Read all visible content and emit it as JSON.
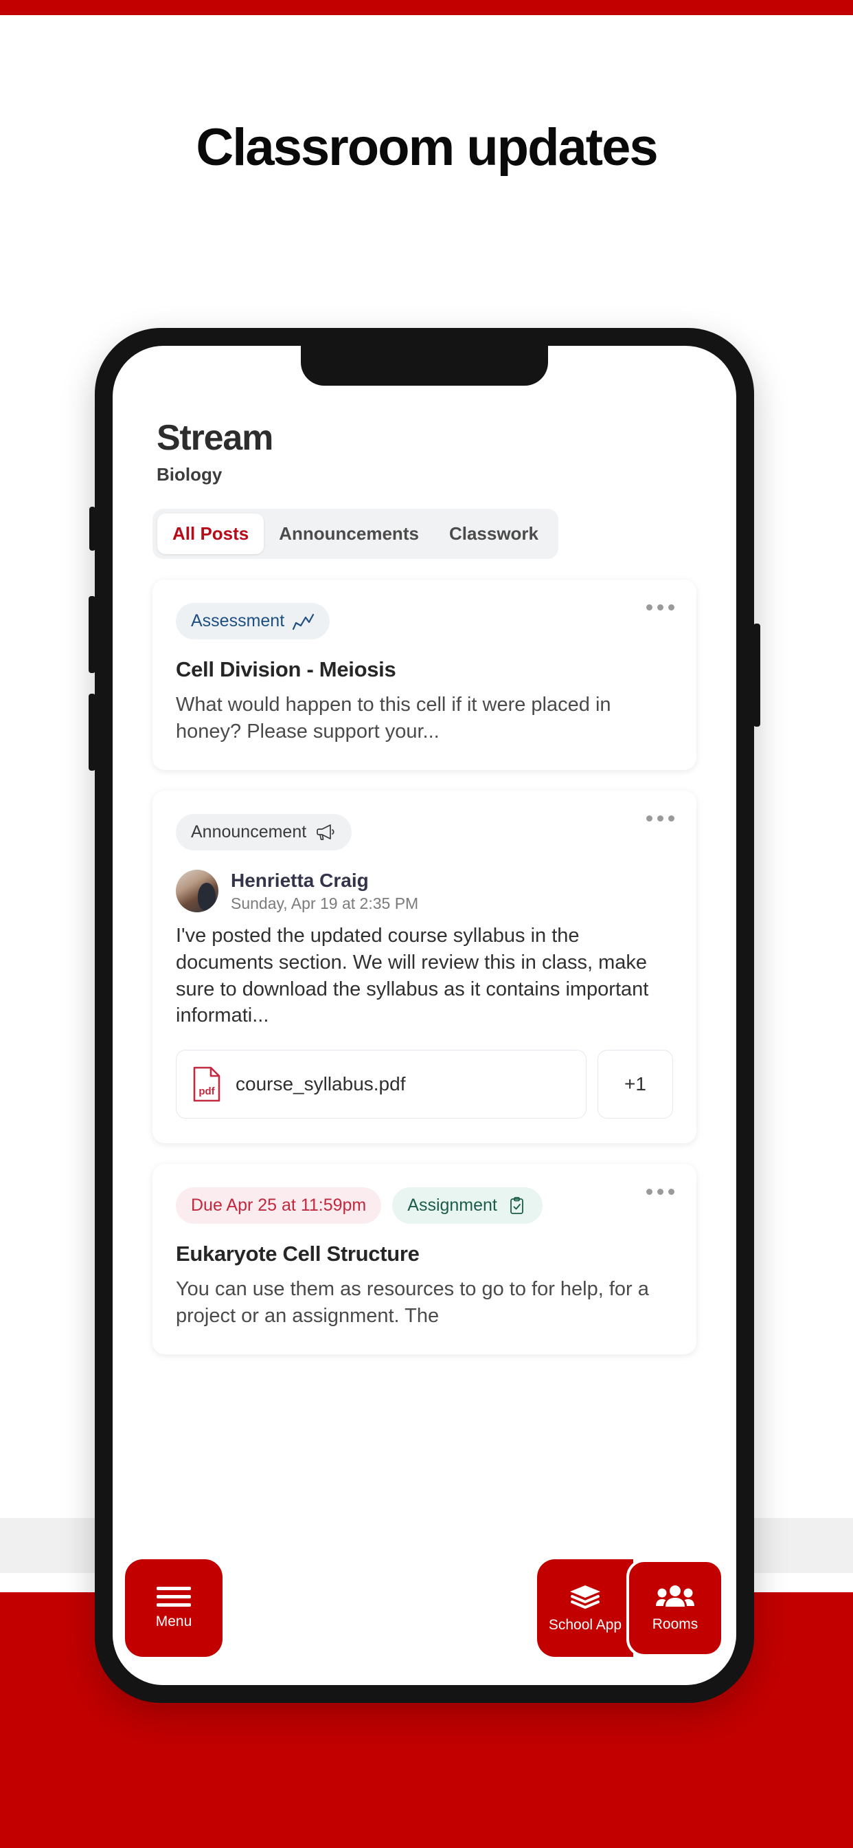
{
  "headline": "Classroom updates",
  "colors": {
    "brand_red": "#C20000",
    "accent_red": "#B80A18",
    "due_red": "#C2283E",
    "assessment_blue": "#1d4f82",
    "assignment_green": "#1c5c4a"
  },
  "app": {
    "title": "Stream",
    "subtitle": "Biology",
    "tabs": [
      {
        "label": "All Posts",
        "active": true
      },
      {
        "label": "Announcements",
        "active": false
      },
      {
        "label": "Classwork",
        "active": false
      }
    ],
    "posts": [
      {
        "badge": "Assessment",
        "badge_icon": "trending-chart-icon",
        "title": "Cell Division - Meiosis",
        "body": "What would happen to this cell if it were placed in honey? Please support your..."
      },
      {
        "badge": "Announcement",
        "badge_icon": "megaphone-icon",
        "author": "Henrietta Craig",
        "timestamp": "Sunday, Apr 19 at 2:35 PM",
        "body": "I've posted the updated course syllabus in the documents section. We will review this in class, make sure to download the syllabus as it contains important informati...",
        "attachments": [
          {
            "name": "course_syllabus.pdf",
            "type": "pdf"
          }
        ],
        "attachments_more": "+1"
      },
      {
        "due_label": "Due Apr 25 at 11:59pm",
        "badge": "Assignment",
        "badge_icon": "clipboard-check-icon",
        "title": "Eukaryote Cell Structure",
        "body": "You can use them as resources to go to for help, for a project or an assignment. The"
      }
    ],
    "bottom_nav": [
      {
        "label": "Menu",
        "icon": "hamburger-icon"
      },
      {
        "label": "School App",
        "icon": "layers-icon"
      },
      {
        "label": "Rooms",
        "icon": "people-icon"
      }
    ]
  }
}
